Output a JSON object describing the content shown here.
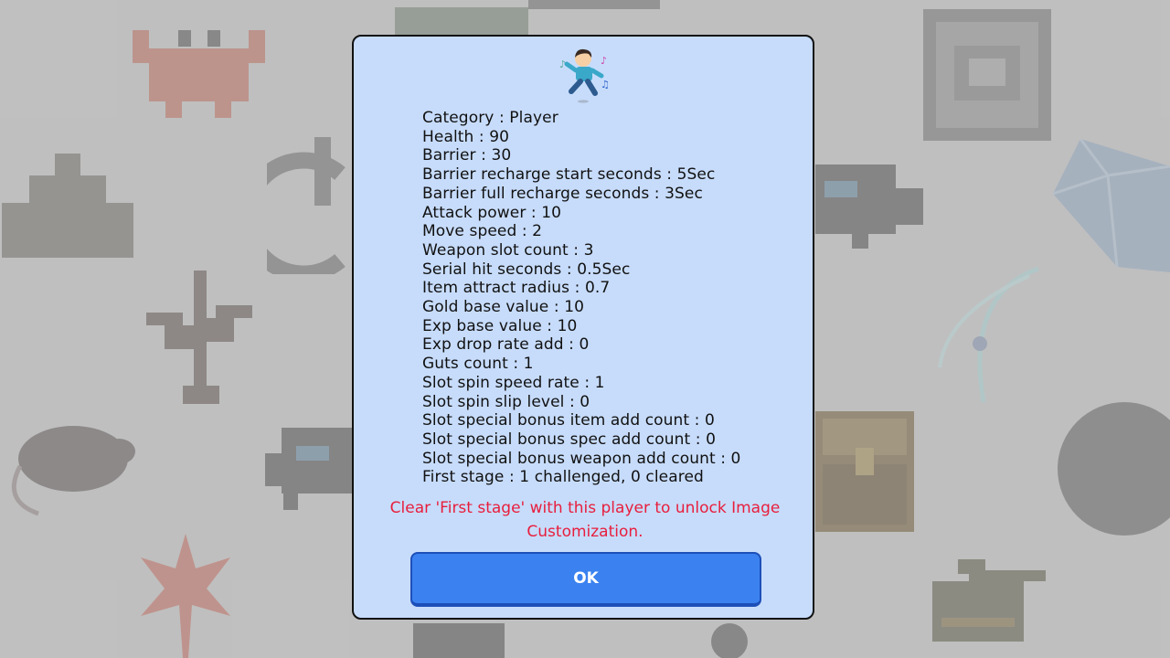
{
  "dialog": {
    "portrait_icon": "dancing-player-icon",
    "stats": [
      "Category : Player",
      "Health : 90",
      "Barrier : 30",
      "Barrier recharge start seconds : 5Sec",
      "Barrier full recharge seconds : 3Sec",
      "Attack power : 10",
      "Move speed : 2",
      "Weapon slot count : 3",
      "Serial hit seconds : 0.5Sec",
      "Item attract radius : 0.7",
      "Gold base value : 10",
      "Exp base value : 10",
      "Exp drop rate add : 0",
      "Guts count : 1",
      "Slot spin speed rate : 1",
      "Slot spin slip level : 0",
      "Slot special bonus item add count : 0",
      "Slot special bonus spec add count : 0",
      "Slot special bonus weapon add count : 0",
      "First stage : 1 challenged, 0 cleared"
    ],
    "unlock_message_line1": "Clear 'First stage' with this player to unlock Image",
    "unlock_message_line2": "Customization.",
    "ok_label": "OK"
  },
  "background_icons": [
    "crab-icon",
    "pyramid-icon",
    "power-icon",
    "plant-icon",
    "rat-icon",
    "leaf-icon",
    "robot-icon",
    "crystal-icon",
    "slash-effect-icon",
    "treasure-chest-icon",
    "circle-icon",
    "tank-icon",
    "fortress-icon"
  ],
  "colors": {
    "dialog_background": "#c7dcfb",
    "ok_button": "#3b82f0",
    "warning_text": "#e81e3c"
  }
}
